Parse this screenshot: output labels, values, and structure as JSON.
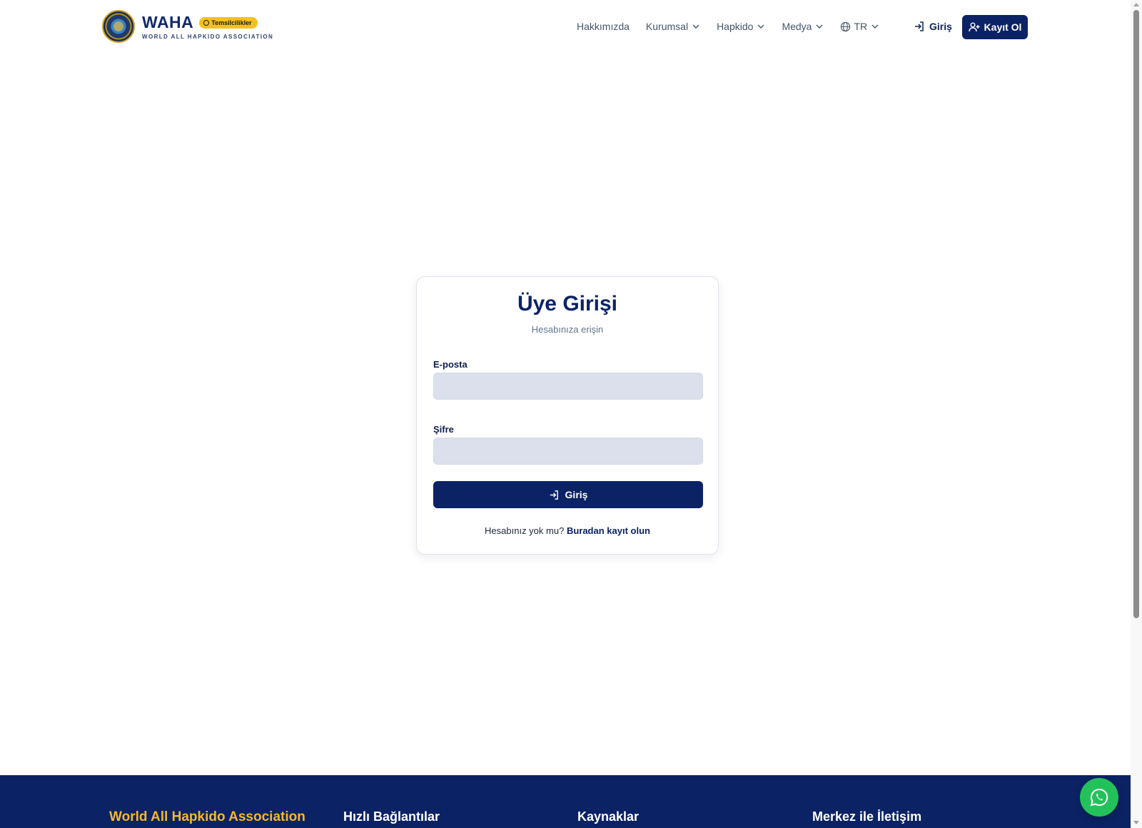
{
  "header": {
    "logo_title": "WAHA",
    "logo_badge": "Temsilcilikler",
    "logo_subtitle": "WORLD ALL HAPKIDO ASSOCIATION",
    "nav": [
      {
        "label": "Hakkımızda"
      },
      {
        "label": "Kurumsal"
      },
      {
        "label": "Hapkido"
      },
      {
        "label": "Medya"
      }
    ],
    "language": "TR",
    "login_label": "Giriş",
    "register_label": "Kayıt Ol"
  },
  "login_card": {
    "title": "Üye Girişi",
    "subtitle": "Hesabınıza erişin",
    "email_label": "E-posta",
    "email_value": "",
    "password_label": "Şifre",
    "password_value": "",
    "submit_label": "Giriş",
    "footer_text": "Hesabınız yok mu?",
    "footer_link": "Buradan kayıt olun"
  },
  "footer": {
    "brand": "World All Hapkido Association",
    "col2_title": "Hızlı Bağlantılar",
    "col3_title": "Kaynaklar",
    "col4_title": "Merkez ile İletişim"
  },
  "colors": {
    "primary": "#0b2265",
    "accent": "#f5b921",
    "input_bg": "#dbe0ec",
    "whatsapp": "#23c15a"
  },
  "icons": [
    "login-icon",
    "user-plus-icon",
    "chevron-down-icon",
    "globe-icon",
    "whatsapp-icon"
  ]
}
